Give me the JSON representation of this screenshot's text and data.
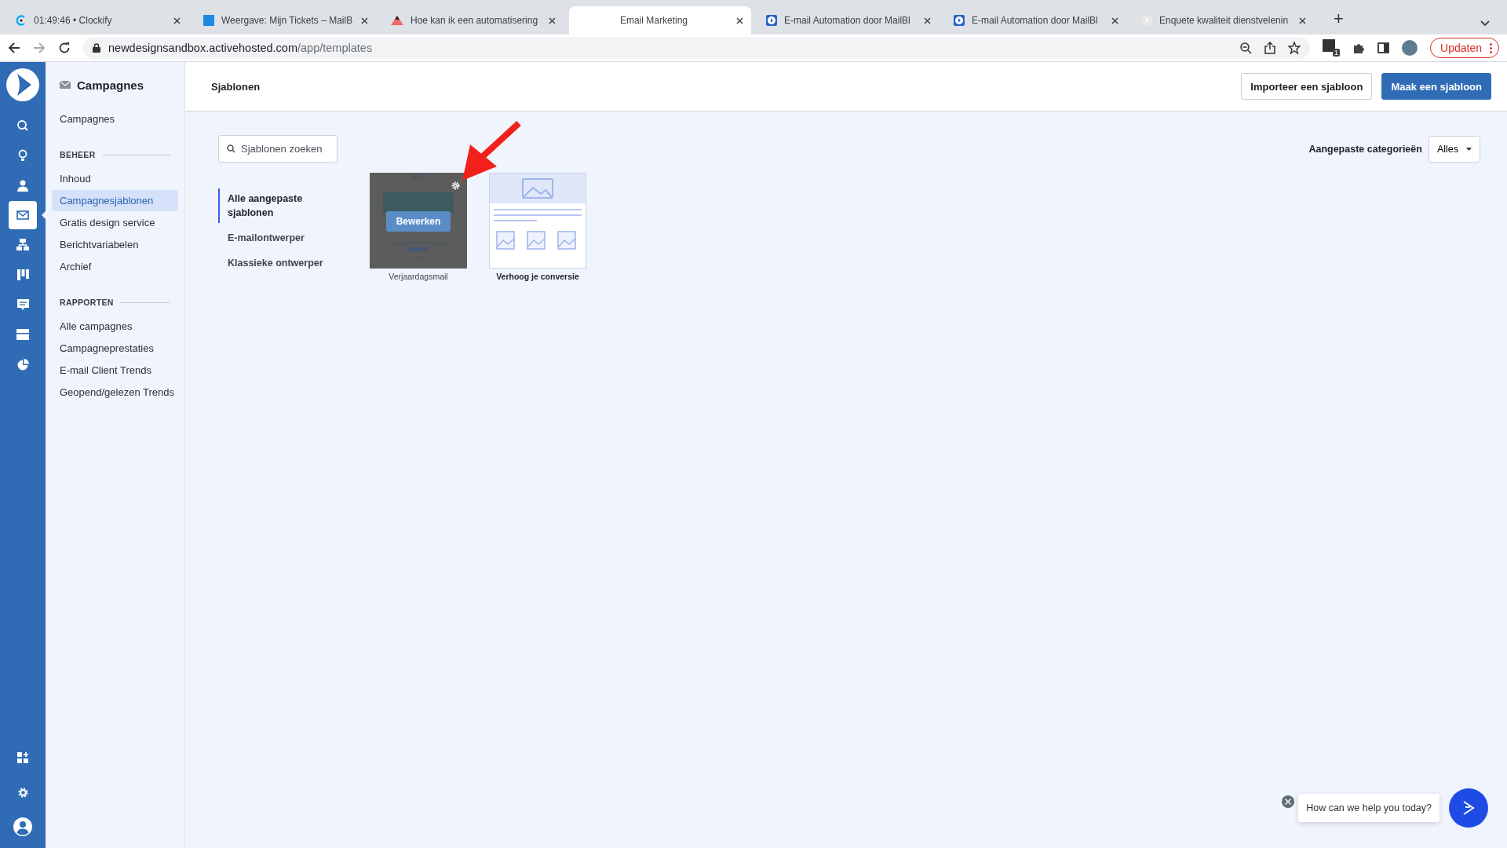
{
  "browser": {
    "tabs": [
      {
        "title": "01:49:46 • Clockify",
        "kind": "clockify",
        "selected": false
      },
      {
        "title": "Weergave: Mijn Tickets – MailB",
        "kind": "square",
        "selected": false
      },
      {
        "title": "Hoe kan ik een automatisering",
        "kind": "triangle",
        "selected": false
      },
      {
        "title": "Email Marketing",
        "kind": "plain",
        "selected": true
      },
      {
        "title": "E-mail Automation door MailBl",
        "kind": "play",
        "selected": false
      },
      {
        "title": "E-mail Automation door MailBl",
        "kind": "play",
        "selected": false
      },
      {
        "title": "Enquete kwaliteit dienstvelenin",
        "kind": "play-round",
        "selected": false
      }
    ],
    "new_tab": "+",
    "url_host": "newdesignsandbox.activehosted.com",
    "url_path": "/app/templates",
    "extension_badge": "1",
    "update_button": "Updaten"
  },
  "rail": {
    "top": [
      {
        "kind": "search",
        "selected": false
      },
      {
        "kind": "bulb",
        "selected": false
      },
      {
        "kind": "contact",
        "selected": false
      },
      {
        "kind": "mail",
        "selected": true
      },
      {
        "kind": "org",
        "selected": false
      },
      {
        "kind": "board",
        "selected": false
      },
      {
        "kind": "chat",
        "selected": false
      },
      {
        "kind": "window",
        "selected": false
      },
      {
        "kind": "pie",
        "selected": false
      }
    ],
    "bottom": [
      {
        "kind": "apps",
        "selected": false
      },
      {
        "kind": "settings",
        "selected": false
      },
      {
        "kind": "account",
        "selected": false
      }
    ]
  },
  "sidebar": {
    "title": "Campagnes",
    "sections": [
      {
        "items": [
          {
            "label": "Campagnes",
            "selected": false
          }
        ]
      },
      {
        "heading": "BEHEER",
        "items": [
          {
            "label": "Inhoud",
            "selected": false
          },
          {
            "label": "Campagnesjablonen",
            "selected": true
          },
          {
            "label": "Gratis design service",
            "selected": false
          },
          {
            "label": "Berichtvariabelen",
            "selected": false
          },
          {
            "label": "Archief",
            "selected": false
          }
        ]
      },
      {
        "heading": "RAPPORTEN",
        "items": [
          {
            "label": "Alle campagnes",
            "selected": false
          },
          {
            "label": "Campagneprestaties",
            "selected": false
          },
          {
            "label": "E-mail Client Trends",
            "selected": false
          },
          {
            "label": "Geopend/gelezen Trends",
            "selected": false
          }
        ]
      }
    ]
  },
  "header": {
    "title": "Sjablonen",
    "buttons": [
      {
        "label": "Importeer een sjabloon",
        "kind": "secondary"
      },
      {
        "label": "Maak een sjabloon",
        "kind": "primary"
      }
    ]
  },
  "search": {
    "placeholder": "Sjablonen zoeken"
  },
  "category_filter": {
    "label": "Aangepaste categorieën",
    "value": "Alles"
  },
  "template_nav": [
    {
      "label": "Alle aangepaste sjablonen",
      "selected": true
    },
    {
      "label": "E-mailontwerper",
      "selected": false
    },
    {
      "label": "Klassieke ontwerper",
      "selected": false
    }
  ],
  "templates": [
    {
      "name": "Verjaardagsmail",
      "kind": "custom",
      "hovered": true,
      "action": "Bewerken"
    },
    {
      "name": "Verhoog je conversie",
      "kind": "placeholder",
      "hovered": false
    }
  ],
  "chat": {
    "message": "How can we help you today?"
  }
}
